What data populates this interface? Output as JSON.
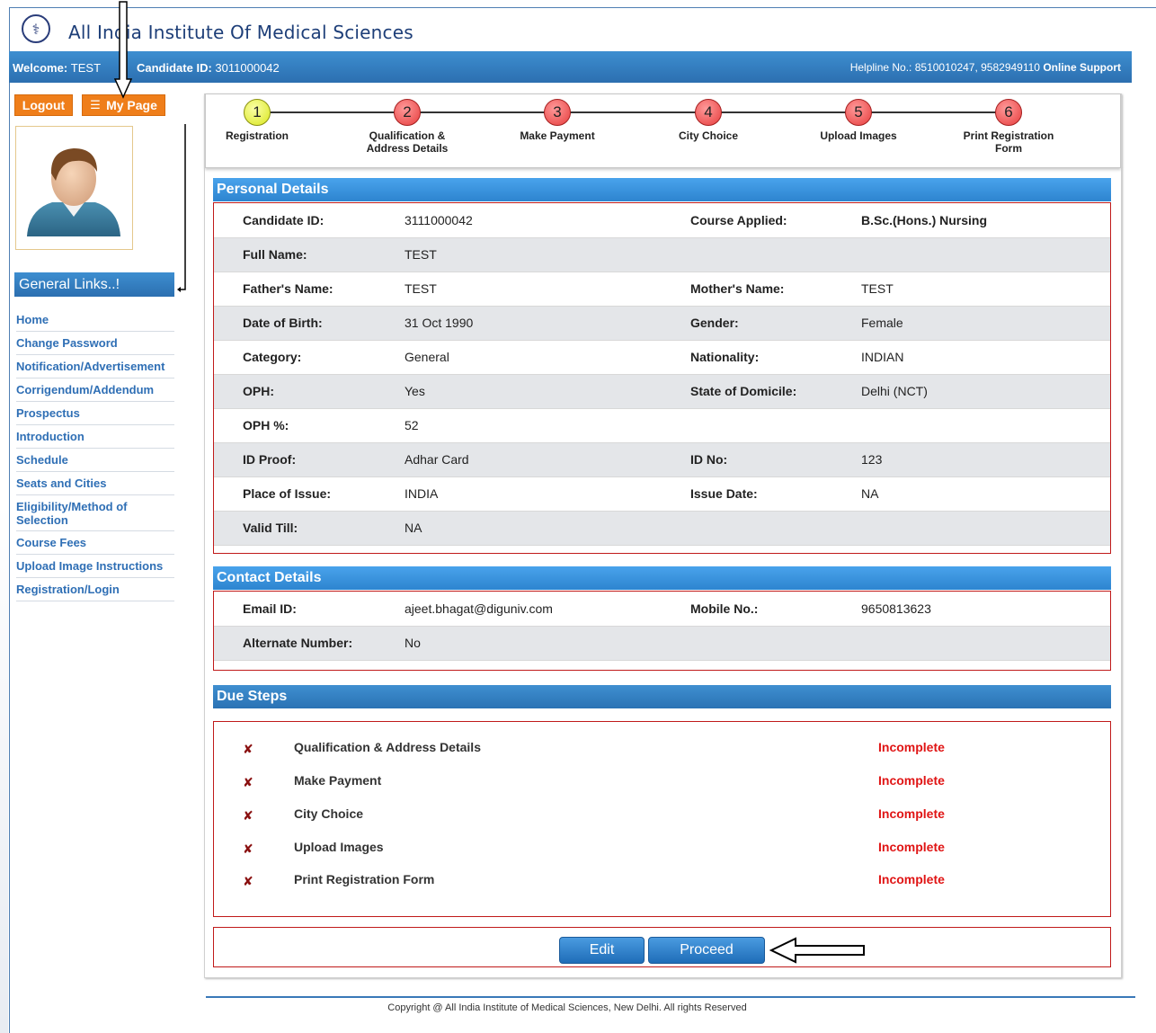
{
  "header": {
    "site_title": "All India Institute Of Medical Sciences",
    "logo_glyph": "⚕"
  },
  "topbar": {
    "welcome_label": "Welcome:",
    "welcome_name": "TEST",
    "candidate_label": "Candidate ID:",
    "candidate_id": "3011000042",
    "helpline_text": "Helpline No.: 8510010247, 9582949110",
    "online_support": "Online Support"
  },
  "sidebar": {
    "logout_label": "Logout",
    "mypage_label": "My Page",
    "general_links_title": "General Links..!",
    "links": [
      "Home",
      "Change Password",
      "Notification/Advertisement",
      "Corrigendum/Addendum",
      "Prospectus",
      "Introduction",
      "Schedule",
      "Seats and Cities",
      "Eligibility/Method of Selection",
      "Course Fees",
      "Upload Image Instructions",
      "Registration/Login"
    ]
  },
  "steps": [
    {
      "num": "1",
      "label": "Registration",
      "state": "done"
    },
    {
      "num": "2",
      "label": "Qualification & Address Details",
      "state": "pending"
    },
    {
      "num": "3",
      "label": "Make Payment",
      "state": "pending"
    },
    {
      "num": "4",
      "label": "City Choice",
      "state": "pending"
    },
    {
      "num": "5",
      "label": "Upload Images",
      "state": "pending"
    },
    {
      "num": "6",
      "label": "Print Registration Form",
      "state": "pending"
    }
  ],
  "personal": {
    "title": "Personal Details",
    "candidate_id_label": "Candidate ID:",
    "candidate_id": "3111000042",
    "course_label": "Course Applied:",
    "course": "B.Sc.(Hons.) Nursing",
    "full_name_label": "Full Name:",
    "full_name": "TEST",
    "father_label": "Father's Name:",
    "father": "TEST",
    "mother_label": "Mother's Name:",
    "mother": "TEST",
    "dob_label": "Date of Birth:",
    "dob": "31 Oct 1990",
    "gender_label": "Gender:",
    "gender": "Female",
    "category_label": "Category:",
    "category": "General",
    "nationality_label": "Nationality:",
    "nationality": "INDIAN",
    "oph_label": "OPH:",
    "oph": "Yes",
    "domicile_label": "State of Domicile:",
    "domicile": "Delhi (NCT)",
    "oph_pct_label": "OPH %:",
    "oph_pct": "52",
    "id_proof_label": "ID Proof:",
    "id_proof": "Adhar Card",
    "id_no_label": "ID No:",
    "id_no": "123",
    "place_label": "Place of Issue:",
    "place": "INDIA",
    "issue_date_label": "Issue Date:",
    "issue_date": "NA",
    "valid_label": "Valid Till:",
    "valid": "NA"
  },
  "contact": {
    "title": "Contact Details",
    "email_label": "Email ID:",
    "email": "ajeet.bhagat@diguniv.com",
    "mobile_label": "Mobile No.:",
    "mobile": "9650813623",
    "alt_label": "Alternate Number:",
    "alt": "No"
  },
  "due": {
    "title": "Due Steps",
    "mark": "✘",
    "items": [
      {
        "name": "Qualification & Address Details",
        "status": "Incomplete"
      },
      {
        "name": "Make Payment",
        "status": "Incomplete"
      },
      {
        "name": "City Choice",
        "status": "Incomplete"
      },
      {
        "name": "Upload Images",
        "status": "Incomplete"
      },
      {
        "name": "Print Registration Form",
        "status": "Incomplete"
      }
    ]
  },
  "actions": {
    "edit_label": "Edit",
    "proceed_label": "Proceed"
  },
  "footer": {
    "copyright": "Copyright @ All India Institute of Medical Sciences, New Delhi. All rights Reserved"
  },
  "colors": {
    "accent_blue": "#2c6fb0",
    "orange": "#ef7e1a",
    "incomplete_red": "#e01515"
  }
}
